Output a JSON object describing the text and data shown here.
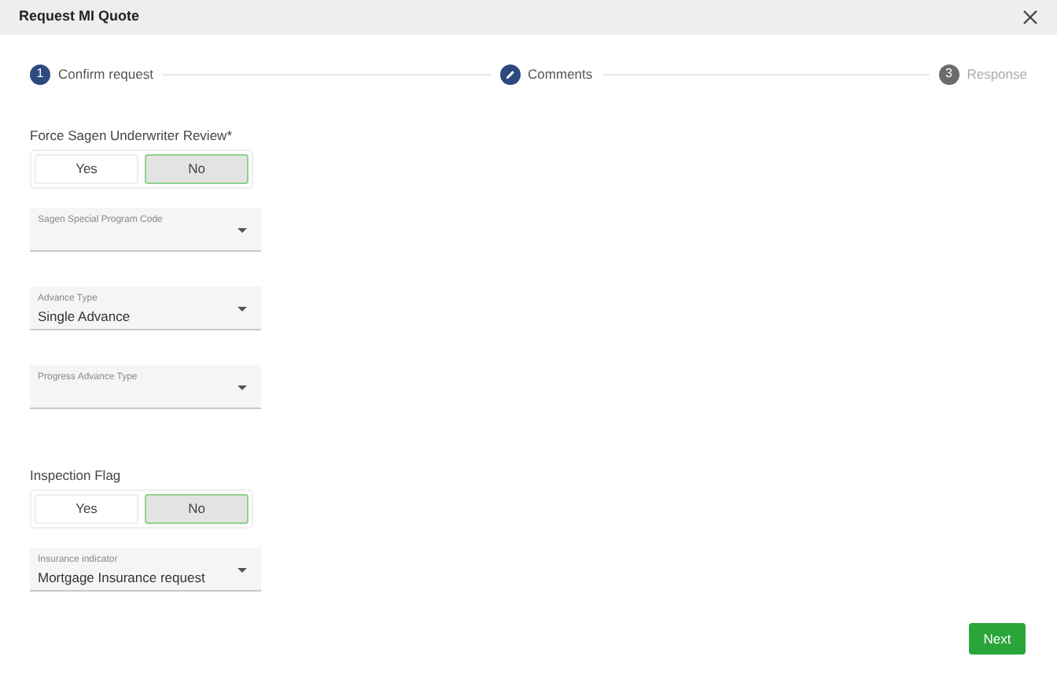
{
  "window": {
    "title": "Request MI Quote"
  },
  "steps": [
    {
      "kind": "number",
      "number": "1",
      "label": "Confirm request",
      "active": true
    },
    {
      "kind": "edit",
      "label": "Comments",
      "active": true
    },
    {
      "kind": "number",
      "number": "3",
      "label": "Response",
      "active": false
    }
  ],
  "form": [
    {
      "kind": "label",
      "text": "Force Sagen Underwriter Review*"
    },
    {
      "kind": "toggle",
      "options": [
        {
          "label": "Yes",
          "selected": false
        },
        {
          "label": "No",
          "selected": true
        }
      ]
    },
    {
      "kind": "select",
      "label": "Sagen Special Program Code"
    },
    {
      "kind": "select",
      "label": "Advance Type",
      "value": "Single Advance"
    },
    {
      "kind": "select",
      "label": "Progress Advance Type"
    },
    {
      "kind": "label",
      "text": "Inspection Flag"
    },
    {
      "kind": "toggle",
      "options": [
        {
          "label": "Yes",
          "selected": false
        },
        {
          "label": "No",
          "selected": true
        }
      ]
    },
    {
      "kind": "select",
      "label": "Insurance indicator",
      "value": "Mortgage Insurance request"
    }
  ],
  "buttons": [
    {
      "label": "Next"
    }
  ]
}
